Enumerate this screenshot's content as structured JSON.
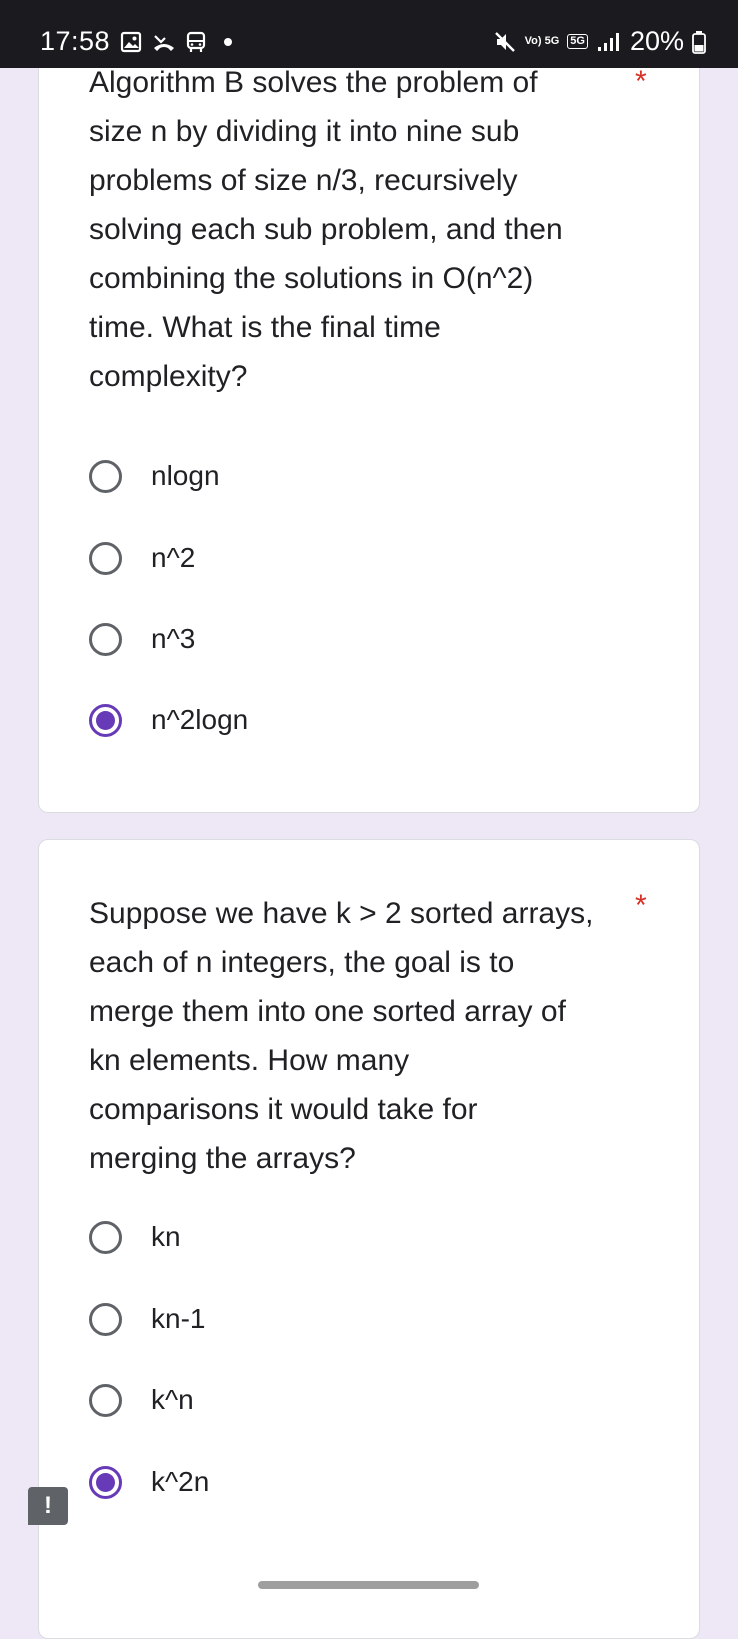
{
  "status_bar": {
    "time": "17:58",
    "battery": "20%",
    "network": "5G",
    "volte": "Vo) 5G",
    "icons": [
      "gallery-icon",
      "missed-call-icon",
      "bus-icon",
      "mute-icon",
      "signal-icon",
      "battery-icon"
    ]
  },
  "questions": [
    {
      "text_lines": [
        "Algorithm B solves the problem of",
        "size n by dividing it into nine sub",
        "problems of size n/3, recursively",
        "solving each sub problem, and then",
        "combining the solutions in O(n^2)",
        "time. What is the final time",
        "complexity?"
      ],
      "required_mark": "*",
      "options": [
        {
          "label": "nlogn",
          "selected": false
        },
        {
          "label": "n^2",
          "selected": false
        },
        {
          "label": "n^3",
          "selected": false
        },
        {
          "label": "n^2logn",
          "selected": true
        }
      ]
    },
    {
      "text_lines": [
        "Suppose we have k > 2 sorted arrays,",
        "each of n integers, the goal is to",
        "merge them into one sorted array of",
        "kn elements. How many",
        "comparisons it would take for",
        "merging the arrays?"
      ],
      "required_mark": "*",
      "options": [
        {
          "label": "kn",
          "selected": false
        },
        {
          "label": "kn-1",
          "selected": false
        },
        {
          "label": "k^n",
          "selected": false
        },
        {
          "label": "k^2n",
          "selected": true
        }
      ]
    }
  ],
  "feedback": {
    "label": "!"
  },
  "colors": {
    "accent": "#673ab7",
    "required": "#d93025",
    "background": "#ede7f6"
  }
}
